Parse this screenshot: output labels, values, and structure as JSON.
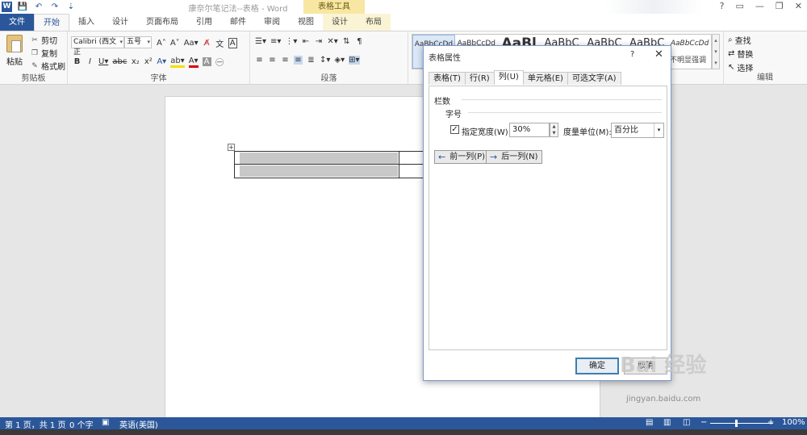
{
  "app": {
    "title": "康奈尔笔记法--表格 - Word",
    "context_tab_group": "表格工具",
    "window_buttons": [
      "?",
      "▭",
      "—",
      "❐",
      "✕"
    ]
  },
  "qat": [
    "W",
    "💾",
    "↶",
    "↷",
    "⇣"
  ],
  "tabs": [
    {
      "label": "文件",
      "kind": "file"
    },
    {
      "label": "开始",
      "kind": "active"
    },
    {
      "label": "插入"
    },
    {
      "label": "设计"
    },
    {
      "label": "页面布局"
    },
    {
      "label": "引用"
    },
    {
      "label": "邮件"
    },
    {
      "label": "审阅"
    },
    {
      "label": "视图"
    },
    {
      "label": "设计",
      "kind": "ctx"
    },
    {
      "label": "布局",
      "kind": "ctx"
    }
  ],
  "ribbon": {
    "clipboard": {
      "paste": "粘贴",
      "cut": "剪切",
      "copy": "复制",
      "format_painter": "格式刷",
      "label": "剪贴板"
    },
    "font": {
      "font_name": "Calibri (西文正",
      "font_size": "五号",
      "label": "字体"
    },
    "paragraph": {
      "label": "段落"
    },
    "styles": {
      "items": [
        "AaBbCcDd",
        "AaBbCcDd",
        "AaBl",
        "AaBbC",
        "AaBbC",
        "AaBbC",
        "AaBbCcDd"
      ],
      "visible_caption": "不明显强调"
    },
    "editing": {
      "find": "查找",
      "replace": "替换",
      "select": "选择",
      "label": "编辑"
    }
  },
  "dialog": {
    "title": "表格属性",
    "help": "?",
    "close": "✕",
    "tabs": [
      "表格(T)",
      "行(R)",
      "列(U)",
      "单元格(E)",
      "可选文字(A)"
    ],
    "active_tab": 2,
    "section_title": "栏数",
    "sub_title": "字号",
    "preferred_width_checked": true,
    "preferred_width_label": "指定宽度(W):",
    "preferred_width_value": "30%",
    "measure_label": "度量单位(M):",
    "measure_value": "百分比",
    "prev_column": "前一列(P)",
    "next_column": "后一列(N)",
    "ok": "确定",
    "cancel": "取消"
  },
  "statusbar": {
    "page": "第 1 页，共 1 页",
    "words": "0 个字",
    "language": "英语(美国)",
    "zoom": "100%"
  },
  "watermark": {
    "main": "Bai 经验",
    "sub": "jingyan.baidu.com"
  }
}
